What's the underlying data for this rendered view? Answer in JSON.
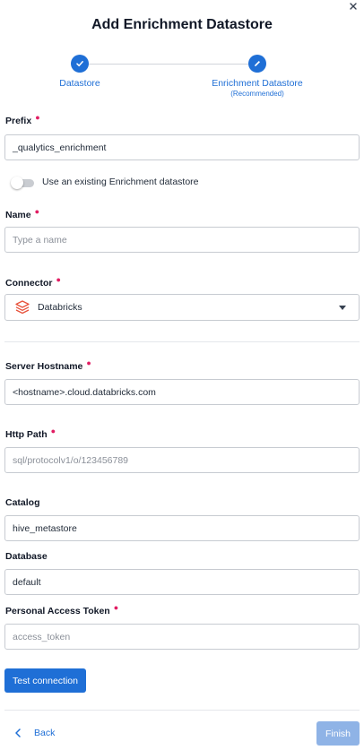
{
  "dialog": {
    "title": "Add Enrichment Datastore"
  },
  "stepper": {
    "steps": [
      {
        "label": "Datastore",
        "sublabel": "",
        "icon": "check-icon",
        "status": "completed"
      },
      {
        "label": "Enrichment Datastore",
        "sublabel": "(Recommended)",
        "icon": "pencil-icon",
        "status": "active"
      }
    ]
  },
  "form": {
    "prefix": {
      "label": "Prefix",
      "value": "_qualytics_enrichment",
      "required": true
    },
    "use_existing": {
      "label": "Use an existing Enrichment datastore",
      "checked": false
    },
    "name": {
      "label": "Name",
      "placeholder": "Type a name",
      "value": "",
      "required": true
    },
    "connector": {
      "label": "Connector",
      "value": "Databricks",
      "icon": "databricks-icon",
      "required": true
    },
    "server_hostname": {
      "label": "Server Hostname",
      "value": "<hostname>.cloud.databricks.com",
      "required": true
    },
    "http_path": {
      "label": "Http Path",
      "placeholder": "sql/protocolv1/o/123456789",
      "value": "",
      "required": true
    },
    "catalog": {
      "label": "Catalog",
      "value": "hive_metastore",
      "required": false
    },
    "database": {
      "label": "Database",
      "value": "default",
      "required": false
    },
    "access_token": {
      "label": "Personal Access Token",
      "placeholder": "access_token",
      "value": "",
      "required": true
    }
  },
  "buttons": {
    "test_connection": "Test connection",
    "back": "Back",
    "finish": "Finish"
  },
  "colors": {
    "accent": "#1f6fd6",
    "required_marker": "#e11d63",
    "finish_disabled": "#8fb3e6"
  }
}
